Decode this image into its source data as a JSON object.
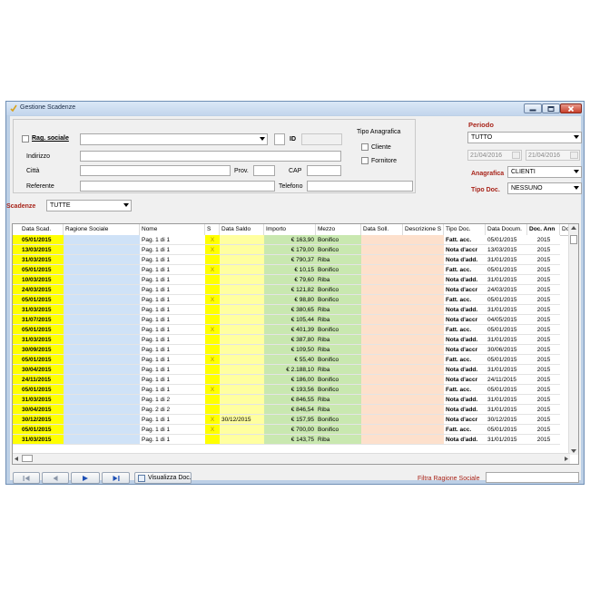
{
  "window": {
    "title": "Gestione Scadenze"
  },
  "filters": {
    "rag_sociale_label": "Rag. sociale",
    "id_label": "ID",
    "indirizzo_label": "Indirizzo",
    "citta_label": "Città",
    "prov_label": "Prov.",
    "cap_label": "CAP",
    "referente_label": "Referente",
    "telefono_label": "Telefono",
    "tipo_anagrafica_label": "Tipo Anagrafica",
    "cliente_label": "Cliente",
    "fornitore_label": "Fornitore"
  },
  "periodo": {
    "label": "Periodo",
    "value": "TUTTO",
    "date_from": "21/04/2016",
    "date_to": "21/04/2016"
  },
  "anagrafica": {
    "label": "Anagrafica",
    "value": "CLIENTI"
  },
  "tipo_doc": {
    "label": "Tipo Doc.",
    "value": "NESSUNO"
  },
  "scadenze": {
    "label": "Scadenze",
    "value": "TUTTE"
  },
  "grid": {
    "columns": [
      "Data Scad.",
      "Ragione Sociale",
      "Nome",
      "S",
      "Data Saldo",
      "Importo",
      "Mezzo",
      "Data Soll.",
      "Descrizione S",
      "Tipo Doc.",
      "Data Docum.",
      "Doc. Ann",
      "Do"
    ],
    "rows": [
      [
        "05/01/2015",
        "",
        "Pag. 1 di 1",
        "X",
        "",
        "€ 163,90",
        "Bonifico",
        "",
        "",
        "Fatt. acc.",
        "05/01/2015",
        "2015"
      ],
      [
        "13/03/2015",
        "",
        "Pag. 1 di 1",
        "X",
        "",
        "€ 179,00",
        "Bonifico",
        "",
        "",
        "Nota d'accr",
        "13/03/2015",
        "2015"
      ],
      [
        "31/03/2015",
        "",
        "Pag. 1 di 1",
        "",
        "",
        "€ 790,37",
        "Riba",
        "",
        "",
        "Nota d'add.",
        "31/01/2015",
        "2015"
      ],
      [
        "05/01/2015",
        "",
        "Pag. 1 di 1",
        "X",
        "",
        "€ 10,15",
        "Bonifico",
        "",
        "",
        "Fatt. acc.",
        "05/01/2015",
        "2015"
      ],
      [
        "10/03/2015",
        "",
        "Pag. 1 di 1",
        "",
        "",
        "€ 79,60",
        "Riba",
        "",
        "",
        "Nota d'add.",
        "31/01/2015",
        "2015"
      ],
      [
        "24/03/2015",
        "",
        "Pag. 1 di 1",
        "",
        "",
        "€ 121,82",
        "Bonifico",
        "",
        "",
        "Nota d'accr",
        "24/03/2015",
        "2015"
      ],
      [
        "05/01/2015",
        "",
        "Pag. 1 di 1",
        "X",
        "",
        "€ 98,80",
        "Bonifico",
        "",
        "",
        "Fatt. acc.",
        "05/01/2015",
        "2015"
      ],
      [
        "31/03/2015",
        "",
        "Pag. 1 di 1",
        "",
        "",
        "€ 380,65",
        "Riba",
        "",
        "",
        "Nota d'add.",
        "31/01/2015",
        "2015"
      ],
      [
        "31/07/2015",
        "",
        "Pag. 1 di 1",
        "",
        "",
        "€ 105,44",
        "Riba",
        "",
        "",
        "Nota d'accr",
        "04/05/2015",
        "2015"
      ],
      [
        "05/01/2015",
        "",
        "Pag. 1 di 1",
        "X",
        "",
        "€ 401,39",
        "Bonifico",
        "",
        "",
        "Fatt. acc.",
        "05/01/2015",
        "2015"
      ],
      [
        "31/03/2015",
        "",
        "Pag. 1 di 1",
        "",
        "",
        "€ 387,80",
        "Riba",
        "",
        "",
        "Nota d'add.",
        "31/01/2015",
        "2015"
      ],
      [
        "30/09/2015",
        "",
        "Pag. 1 di 1",
        "",
        "",
        "€ 109,50",
        "Riba",
        "",
        "",
        "Nota d'accr",
        "30/06/2015",
        "2015"
      ],
      [
        "05/01/2015",
        "",
        "Pag. 1 di 1",
        "X",
        "",
        "€ 55,40",
        "Bonifico",
        "",
        "",
        "Fatt. acc.",
        "05/01/2015",
        "2015"
      ],
      [
        "30/04/2015",
        "",
        "Pag. 1 di 1",
        "",
        "",
        "€ 2.188,10",
        "Riba",
        "",
        "",
        "Nota d'add.",
        "31/01/2015",
        "2015"
      ],
      [
        "24/11/2015",
        "",
        "Pag. 1 di 1",
        "",
        "",
        "€ 186,00",
        "Bonifico",
        "",
        "",
        "Nota d'accr",
        "24/11/2015",
        "2015"
      ],
      [
        "05/01/2015",
        "",
        "Pag. 1 di 1",
        "X",
        "",
        "€ 193,56",
        "Bonifico",
        "",
        "",
        "Fatt. acc.",
        "05/01/2015",
        "2015"
      ],
      [
        "31/03/2015",
        "",
        "Pag. 1 di 2",
        "",
        "",
        "€ 846,55",
        "Riba",
        "",
        "",
        "Nota d'add.",
        "31/01/2015",
        "2015"
      ],
      [
        "30/04/2015",
        "",
        "Pag. 2 di 2",
        "",
        "",
        "€ 846,54",
        "Riba",
        "",
        "",
        "Nota d'add.",
        "31/01/2015",
        "2015"
      ],
      [
        "30/12/2015",
        "",
        "Pag. 1 di 1",
        "X",
        "30/12/2015",
        "€ 157,95",
        "Bonifico",
        "",
        "",
        "Nota d'accr",
        "30/12/2015",
        "2015"
      ],
      [
        "05/01/2015",
        "",
        "Pag. 1 di 1",
        "X",
        "",
        "€ 700,00",
        "Bonifico",
        "",
        "",
        "Fatt. acc.",
        "05/01/2015",
        "2015"
      ],
      [
        "31/03/2015",
        "",
        "Pag. 1 di 1",
        "",
        "",
        "€ 143,75",
        "Riba",
        "",
        "",
        "Nota d'add.",
        "31/01/2015",
        "2015"
      ]
    ]
  },
  "footer": {
    "visualizza_label": "Visualizza Doc.",
    "filtra_label": "Filtra Ragione Sociale"
  },
  "colors": {
    "date_column": "#ffff00",
    "ragione_column": "#cfe2f7",
    "check_column": "#ffff00",
    "saldo_column": "#ffffa0",
    "importo_column": "#c9e8b0",
    "sollecito_column": "#fde0cc",
    "accent_red": "#a8241a"
  }
}
